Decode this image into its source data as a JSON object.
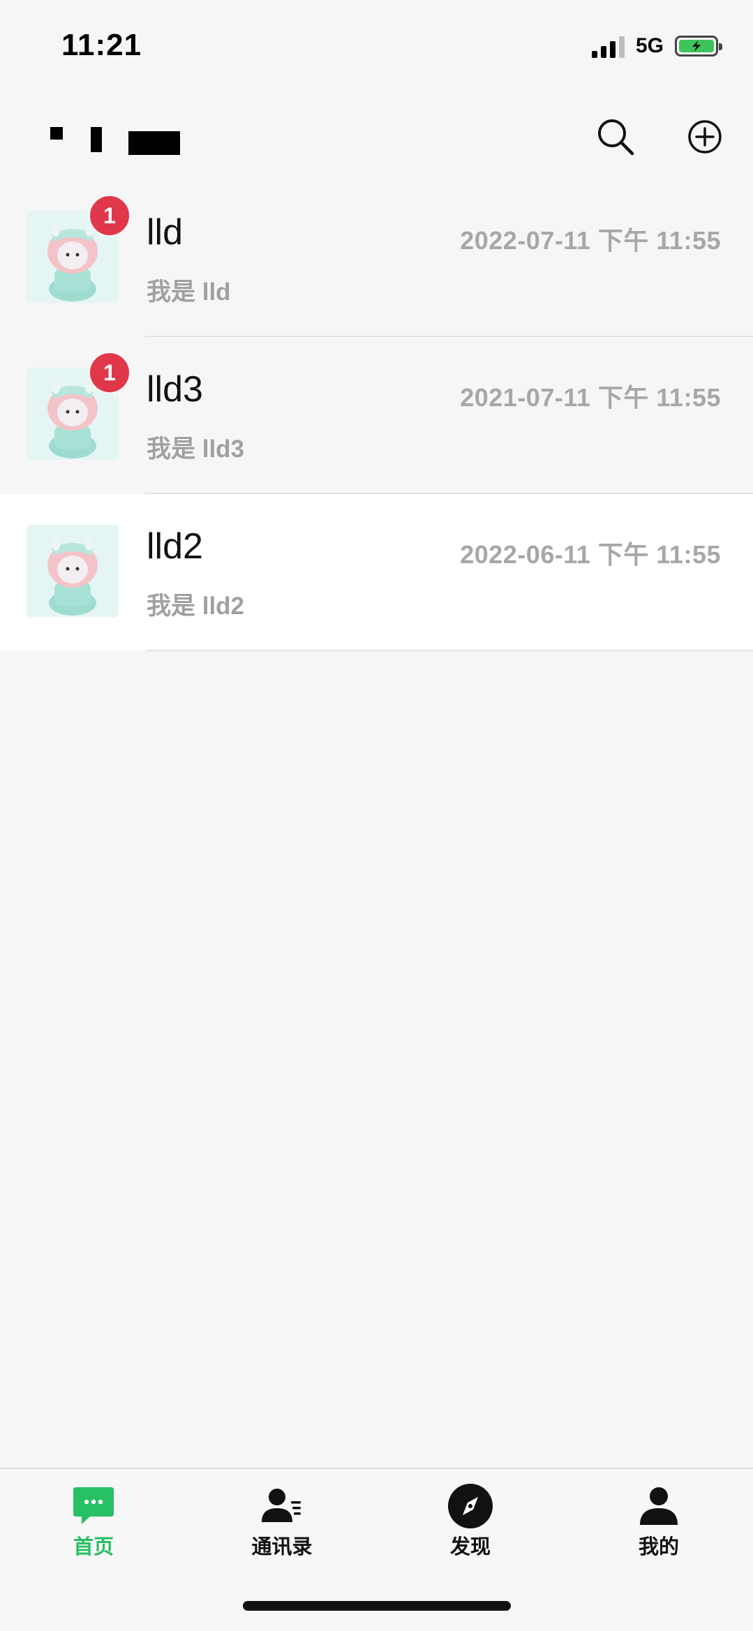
{
  "status_bar": {
    "time": "11:21",
    "network": "5G",
    "signal_icon": "cellular-signal-icon",
    "battery_icon": "battery-charging-icon"
  },
  "header": {
    "title": "",
    "search_icon": "search-icon",
    "add_icon": "plus-circle-icon"
  },
  "chats": [
    {
      "name": "lld",
      "time": "2022-07-11 下午 11:55",
      "preview": "我是 lld",
      "unread": "1"
    },
    {
      "name": "lld3",
      "time": "2021-07-11 下午 11:55",
      "preview": "我是 lld3",
      "unread": "1"
    },
    {
      "name": "lld2",
      "time": "2022-06-11 下午 11:55",
      "preview": "我是 lld2",
      "unread": ""
    }
  ],
  "tabs": [
    {
      "label": "首页",
      "icon": "chat-bubble-icon",
      "active": true
    },
    {
      "label": "通讯录",
      "icon": "contacts-icon",
      "active": false
    },
    {
      "label": "发现",
      "icon": "compass-icon",
      "active": false
    },
    {
      "label": "我的",
      "icon": "profile-icon",
      "active": false
    }
  ],
  "colors": {
    "accent": "#27c062",
    "badge": "#e0374b",
    "background": "#f6f6f6"
  }
}
